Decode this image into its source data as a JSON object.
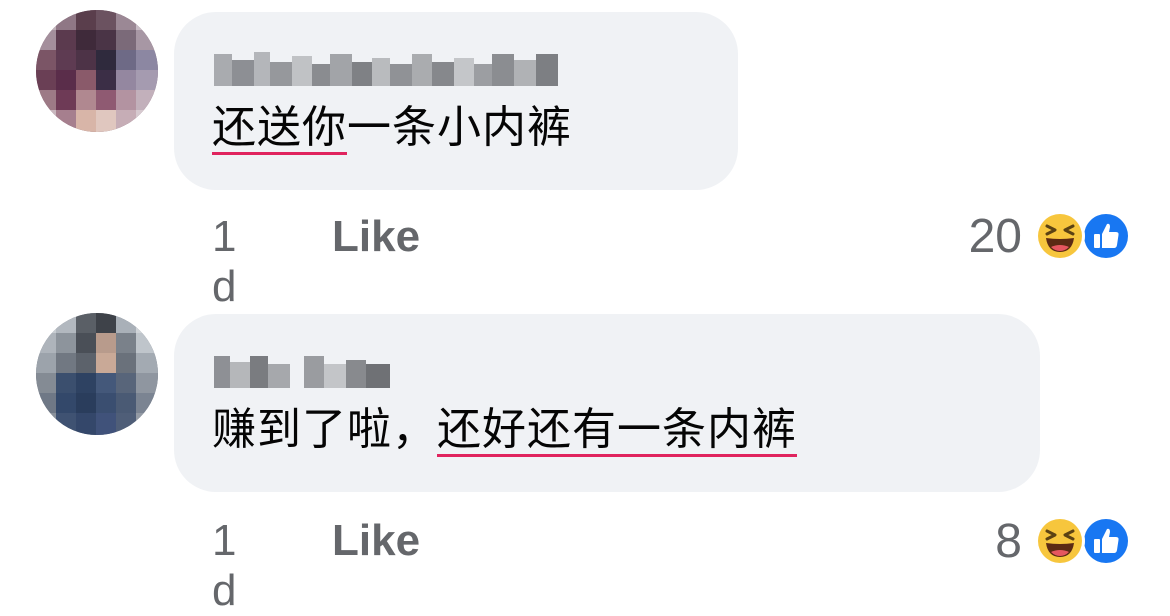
{
  "comments": [
    {
      "text_underlined": "还送你",
      "text_rest": "一条小内裤",
      "time": "1 d",
      "like_label": "Like",
      "reaction_count": "20",
      "reaction_icons": [
        "haha-icon",
        "like-thumb-icon"
      ]
    },
    {
      "text_plain": "赚到了啦，",
      "text_underlined": "还好还有一条内裤",
      "time": "1 d",
      "like_label": "Like",
      "reaction_count": "8",
      "reaction_icons": [
        "haha-icon",
        "like-thumb-icon"
      ]
    }
  ],
  "colors": {
    "bubble_bg": "#f0f2f5",
    "meta_text": "#65676b",
    "underline": "#e0245e",
    "like_blue": "#1877f2",
    "haha_yellow": "#f7c63d"
  }
}
